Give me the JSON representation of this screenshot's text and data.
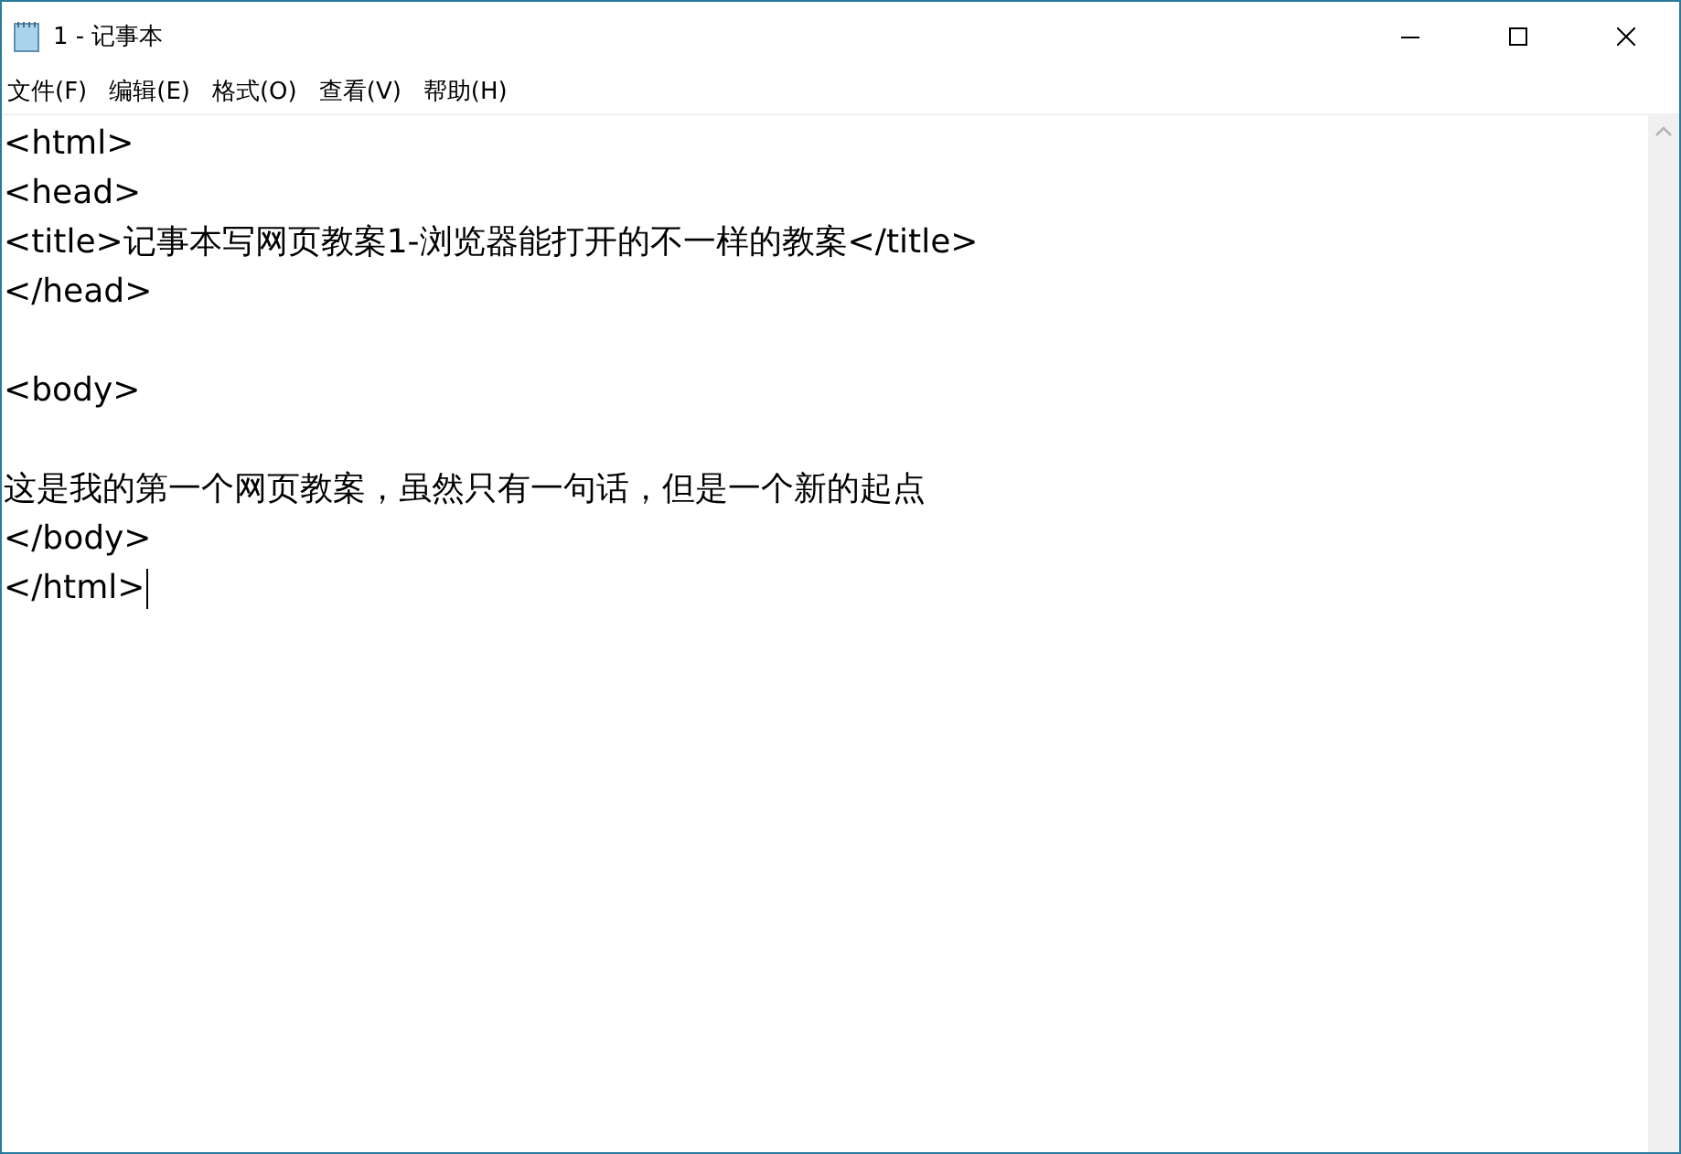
{
  "window": {
    "title": "1 - 记事本"
  },
  "menu": [
    "文件(F)",
    "编辑(E)",
    "格式(O)",
    "查看(V)",
    "帮助(H)"
  ],
  "editor": {
    "text": "<html>\n<head>\n<title>记事本写网页教案1-浏览器能打开的不一样的教案</title>\n</head>\n\n<body>\n\n这是我的第一个网页教案，虽然只有一句话，但是一个新的起点\n</body>",
    "current_line": "</html>"
  }
}
